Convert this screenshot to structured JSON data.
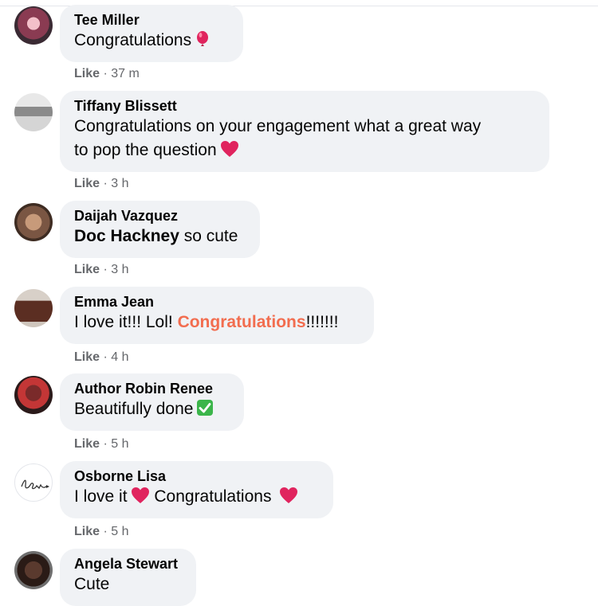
{
  "comments": [
    {
      "name": "Tee Miller",
      "parts": [
        "Congratulations"
      ],
      "time": "37 m",
      "emoji": "balloon-icon"
    },
    {
      "name": "Tiffany Blissett",
      "line1": "Congratulations on your engagement what a great way",
      "line2": "to pop the question",
      "time": "3 h",
      "emoji": "heart-icon"
    },
    {
      "name": "Daijah Vazquez",
      "mention": "Doc Hackney",
      "rest": " so cute",
      "time": "3 h"
    },
    {
      "name": "Emma Jean",
      "pre": "I love it!!! Lol! ",
      "highlight": "Congratulations",
      "post": "!!!!!!!",
      "time": "4 h"
    },
    {
      "name": "Author Robin Renee",
      "text": "Beautifully done",
      "time": "5 h",
      "emoji": "check-mark-icon"
    },
    {
      "name": "Osborne Lisa",
      "pre": "I love it",
      "mid": " Congratulations ",
      "time": "5 h",
      "emoji": "heart-icon"
    },
    {
      "name": "Angela Stewart",
      "text": "Cute"
    }
  ],
  "like_label": "Like",
  "separator": " · ",
  "colors": {
    "bubble": "#f0f2f5",
    "meta": "#65676b",
    "highlight": "#f26d4f",
    "heart": "#e0245e"
  }
}
